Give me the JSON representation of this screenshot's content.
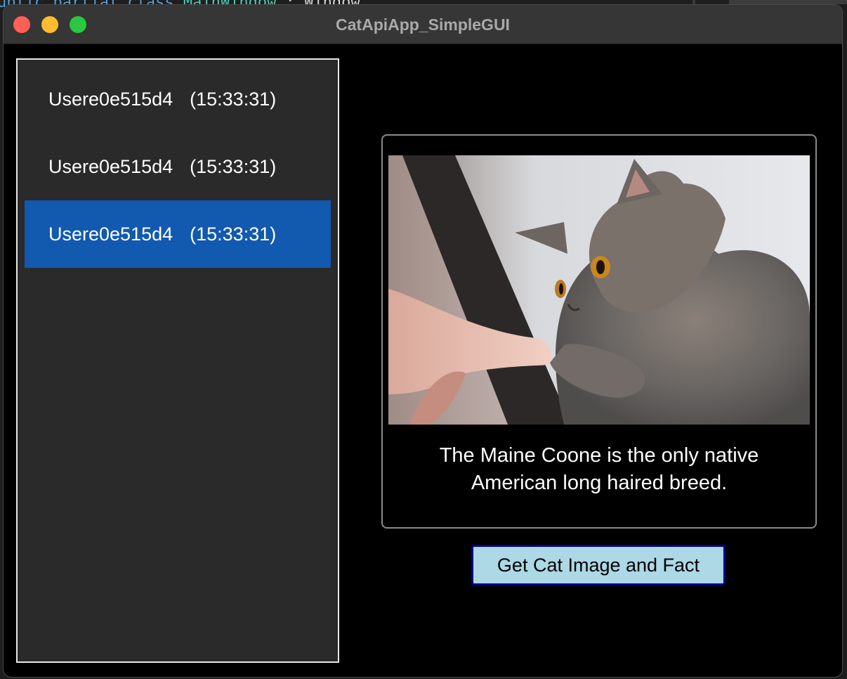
{
  "background_editor": {
    "code_line": {
      "keywords": "ublic partial class ",
      "class_name": "MainWindow",
      "rest": " : Window"
    }
  },
  "window": {
    "title": "CatApiApp_SimpleGUI",
    "controls": [
      "close",
      "minimize",
      "zoom"
    ]
  },
  "user_list": {
    "items": [
      {
        "user": "Usere0e515d4",
        "time": "(15:33:31)",
        "selected": false
      },
      {
        "user": "Usere0e515d4",
        "time": "(15:33:31)",
        "selected": false
      },
      {
        "user": "Usere0e515d4",
        "time": "(15:33:31)",
        "selected": true
      }
    ]
  },
  "cat_card": {
    "image_icon": "cat-photo",
    "fact_line1": "The Maine Coone is the only native",
    "fact_line2": "American long haired breed."
  },
  "action": {
    "button_label": "Get Cat Image and Fact"
  },
  "colors": {
    "selected_item": "#1259b0",
    "button_fill": "#add8e6",
    "button_border": "#00008b",
    "list_background": "#2a2a2a"
  }
}
